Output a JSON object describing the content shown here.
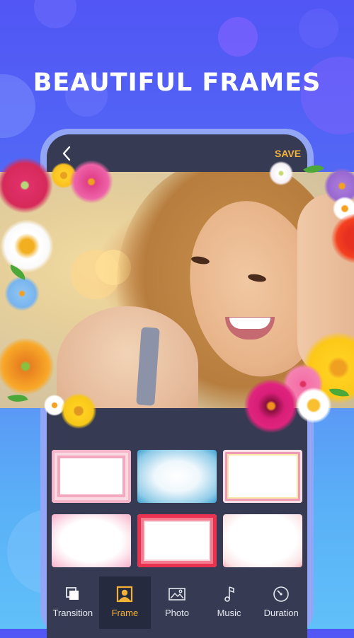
{
  "headline": "BEAUTIFUL FRAMES",
  "editor": {
    "back_label": "Back",
    "save_label": "SAVE"
  },
  "colors": {
    "accent": "#f3b23a",
    "screen_bg": "#363b53",
    "active_tab_bg": "#262a3e",
    "bg_top": "#5156f5",
    "bg_bottom": "#60c0f8"
  },
  "frames": [
    {
      "name": "Pink bouquet frame",
      "style": "pink"
    },
    {
      "name": "Blue frost frame",
      "style": "blue"
    },
    {
      "name": "Pink dotted border frame",
      "style": "dots"
    },
    {
      "name": "Floral corners frame",
      "style": "flora"
    },
    {
      "name": "Red petals frame",
      "style": "red"
    },
    {
      "name": "Petal spray frame",
      "style": "spray"
    }
  ],
  "tabs": [
    {
      "label": "Transition",
      "icon": "transition-icon",
      "active": false
    },
    {
      "label": "Frame",
      "icon": "frame-portrait-icon",
      "active": true
    },
    {
      "label": "Photo",
      "icon": "image-icon",
      "active": false
    },
    {
      "label": "Music",
      "icon": "music-note-icon",
      "active": false
    },
    {
      "label": "Duration",
      "icon": "timer-icon",
      "active": false
    }
  ]
}
